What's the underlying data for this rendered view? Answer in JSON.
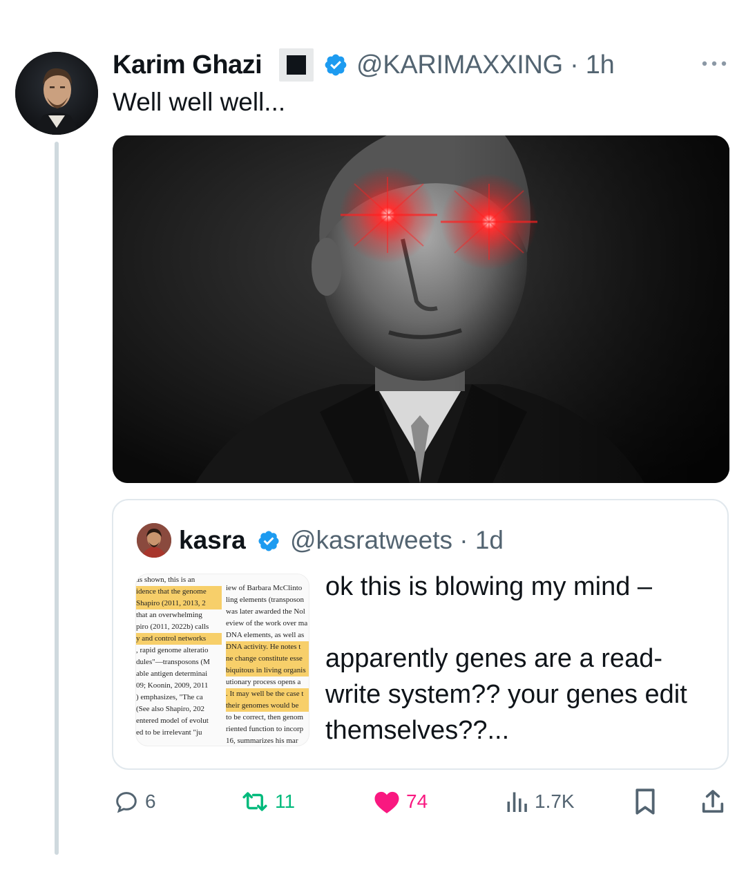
{
  "tweet": {
    "author_name": "Karim Ghazi",
    "handle_and_time": "@KARIMAXXING · 1h",
    "text": "Well well well..."
  },
  "quoted_tweet": {
    "author_name": "kasra",
    "handle_and_time": "@kasratweets · 1d",
    "text_line1": "ok this is blowing my mind –",
    "text_line2": "apparently genes are a read-write system?? your genes edit themselves??...",
    "thumbnail_left_lines": [
      "as shown, this is an",
      "idence that the genome",
      "Shapiro (2011, 2013, 2",
      " that an overwhelming",
      "piro (2011, 2022b) calls",
      "y and control networks",
      ", rapid genome alteratio",
      "dules\"—transposons (M",
      "able antigen determinai",
      "09; Koonin, 2009, 2011",
      ") emphasizes, \"The ca",
      " (See also Shapiro, 202",
      "entered model of evolut",
      "ed to be irrelevant \"ju"
    ],
    "thumbnail_right_lines": [
      "iew of Barbara McClinto",
      "ling elements (transposon",
      "was later awarded the Nol",
      "eview of the work over ma",
      "DNA elements, as well as",
      "DNA activity. He notes t",
      "ne change constitute esse",
      "biquitous in living organis",
      "utionary process opens a",
      ". It may well be the case t",
      " their genomes would be",
      "to be correct, then genom",
      "riented function to incorp",
      "",
      "16, summarizes his mar"
    ]
  },
  "actions": {
    "replies": "6",
    "reposts": "11",
    "likes": "74",
    "views": "1.7K"
  },
  "colors": {
    "verified": "#1d9bf0",
    "like": "#f91880",
    "repost": "#00ba7c",
    "secondary_text": "#536471",
    "laser_eye": "#ff1a1a"
  },
  "icons": [
    "more-dots-icon",
    "verified-badge-icon",
    "reply-icon",
    "repost-icon",
    "heart-icon",
    "views-icon",
    "bookmark-icon",
    "share-icon"
  ]
}
